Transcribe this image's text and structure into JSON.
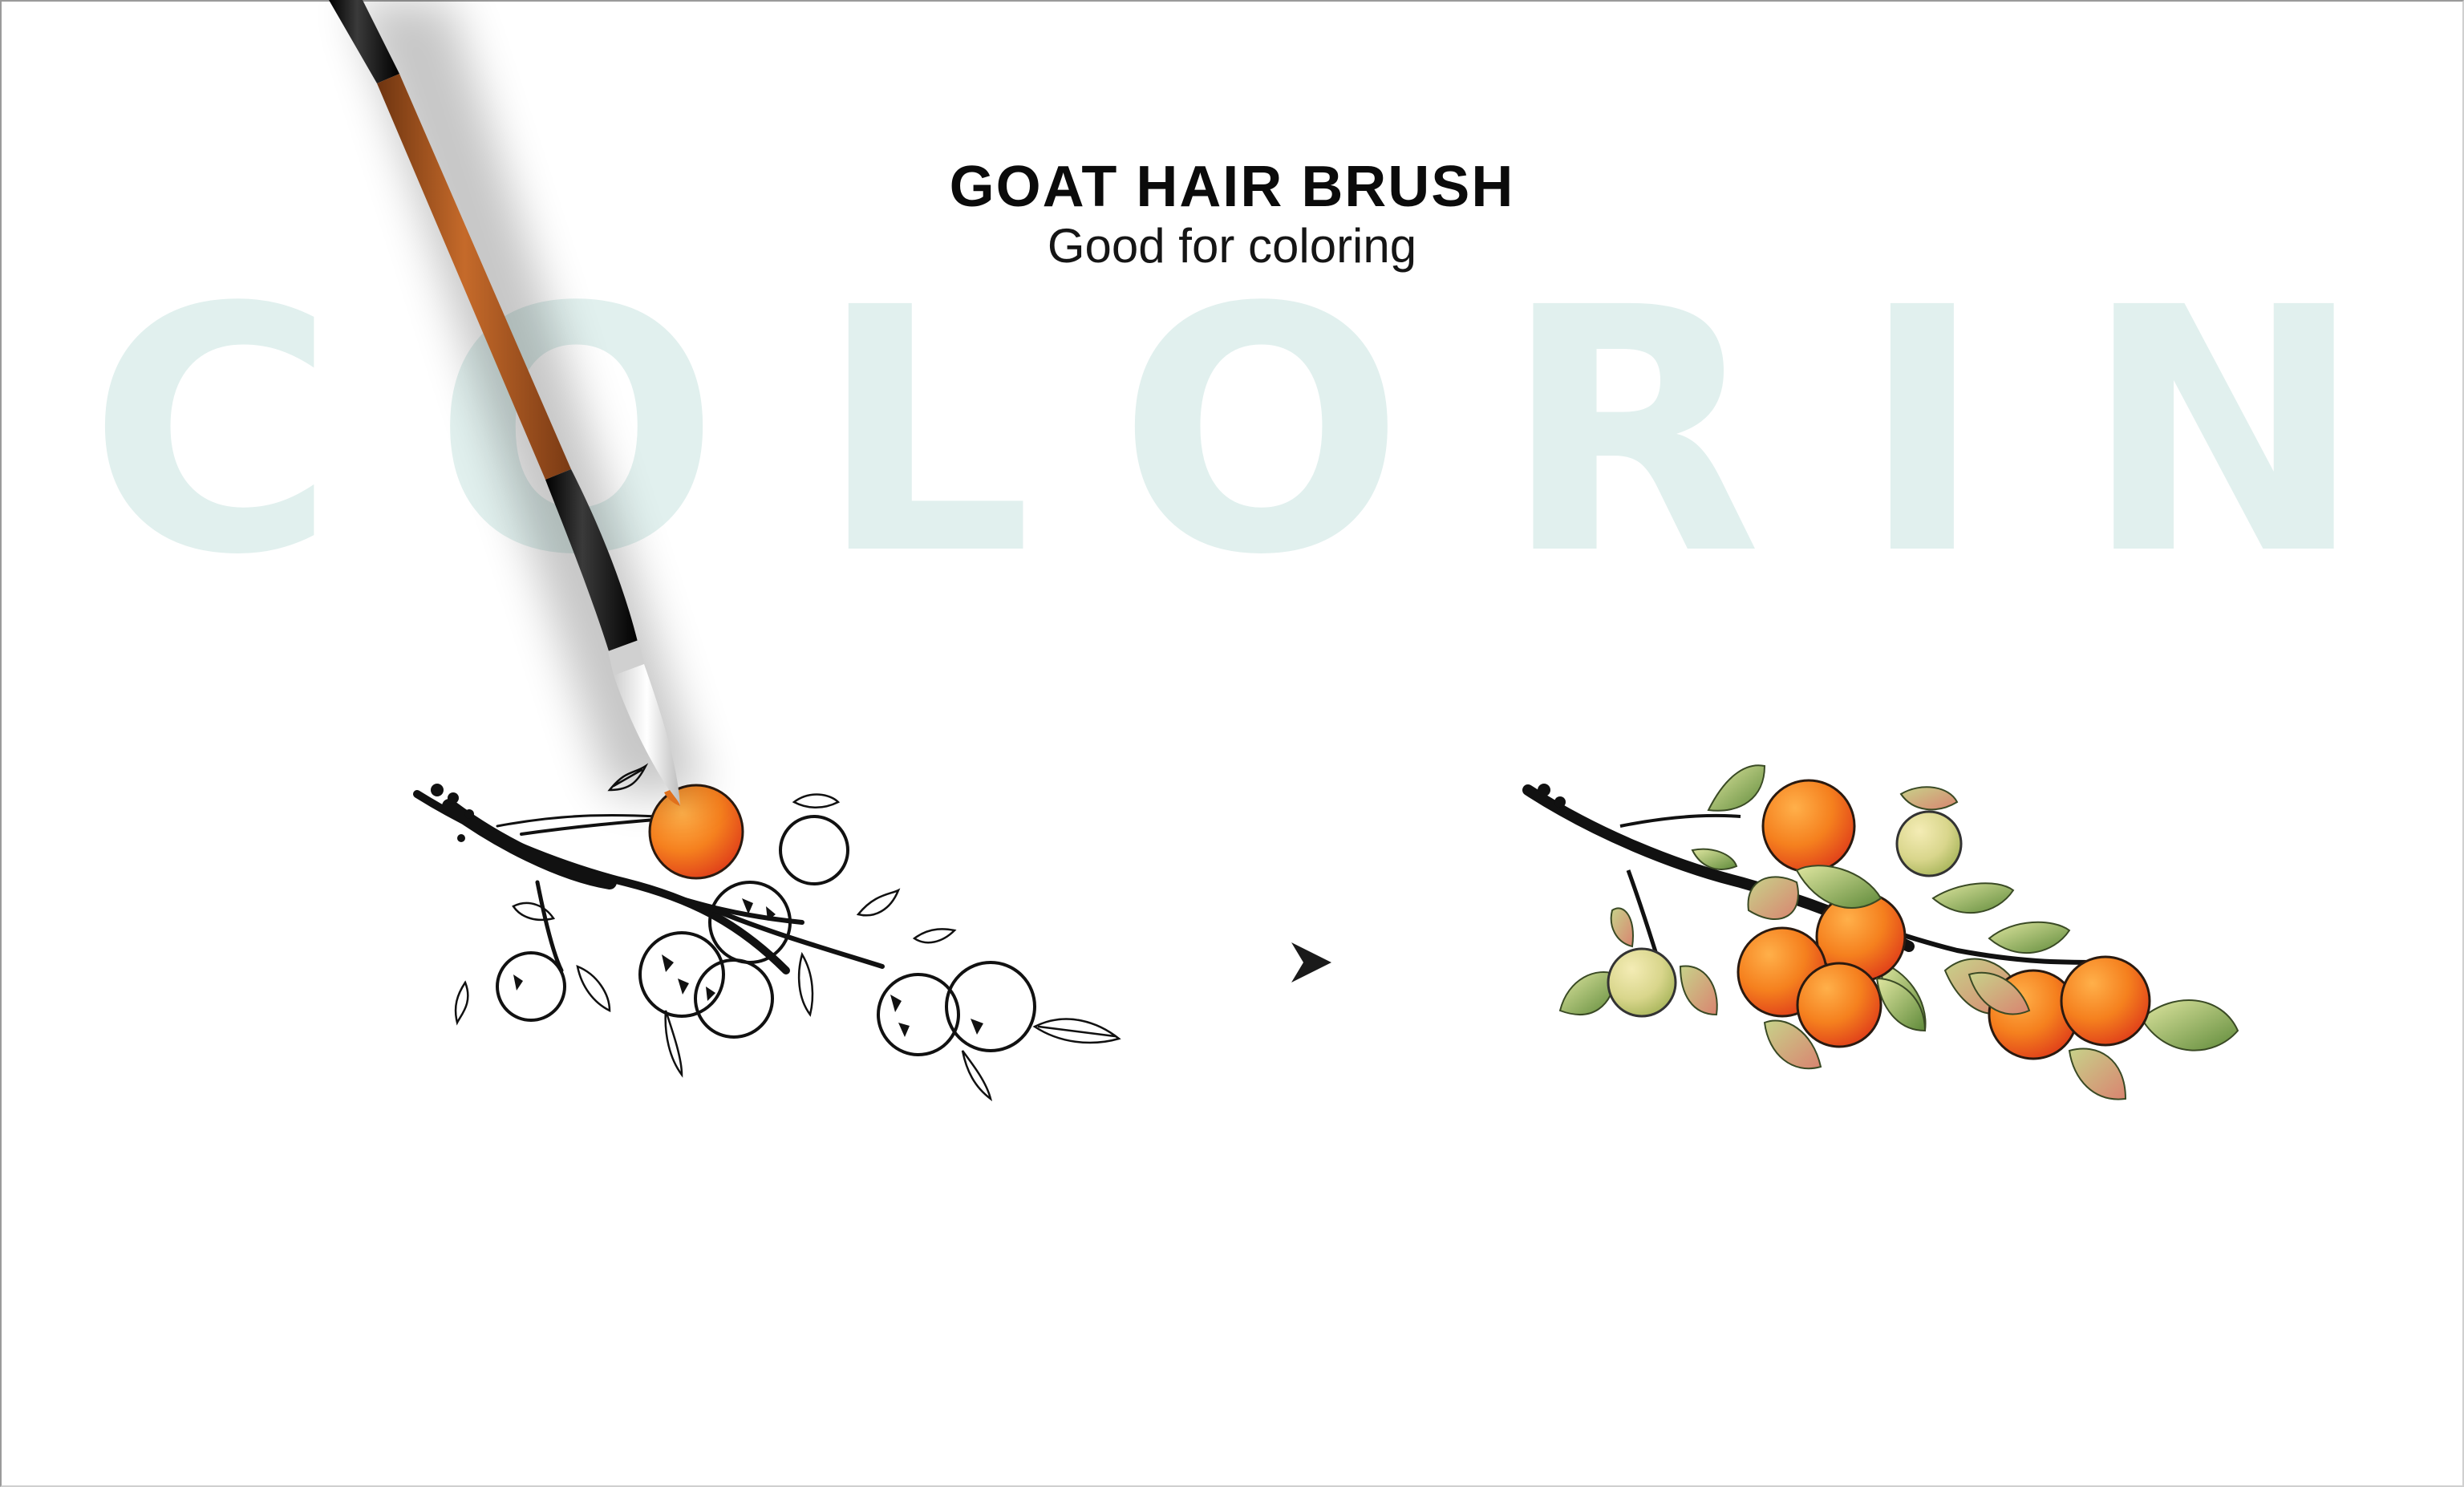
{
  "header": {
    "title": "GOAT HAIR BRUSH",
    "subtitle": "Good for coloring"
  },
  "background_word": "COLORING",
  "icons": {
    "brush": "goat-hair-brush-icon",
    "arrow": "arrow-right-icon"
  },
  "colors": {
    "background_word": "#e1f0ee",
    "brush_handle": "#a4521e",
    "fruit": "#f07a1e",
    "leaf": "#8fa65a",
    "ink": "#111111"
  }
}
